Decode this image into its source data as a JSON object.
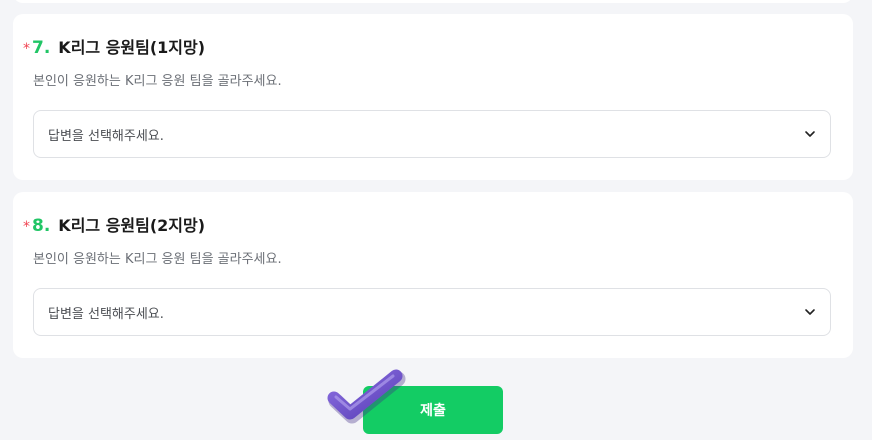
{
  "questions": [
    {
      "required_mark": "*",
      "number": "7.",
      "title": "K리그 응원팀(1지망)",
      "description": "본인이 응원하는 K리그 응원 팀을 골라주세요.",
      "select_value": "답변을 선택해주세요.",
      "icon": "chevron-down-icon"
    },
    {
      "required_mark": "*",
      "number": "8.",
      "title": "K리그 응원팀(2지망)",
      "description": "본인이 응원하는 K리그 응원 팀을 골라주세요.",
      "select_value": "답변을 선택해주세요.",
      "icon": "chevron-down-icon"
    }
  ],
  "submit": {
    "label": "제출",
    "color": "#13cc64"
  },
  "overlay": {
    "icon": "checkmark-icon",
    "color": "#6a4fc8"
  },
  "colors": {
    "required": "#f04452",
    "question_number": "#20c565",
    "background": "#f4f5f8"
  }
}
